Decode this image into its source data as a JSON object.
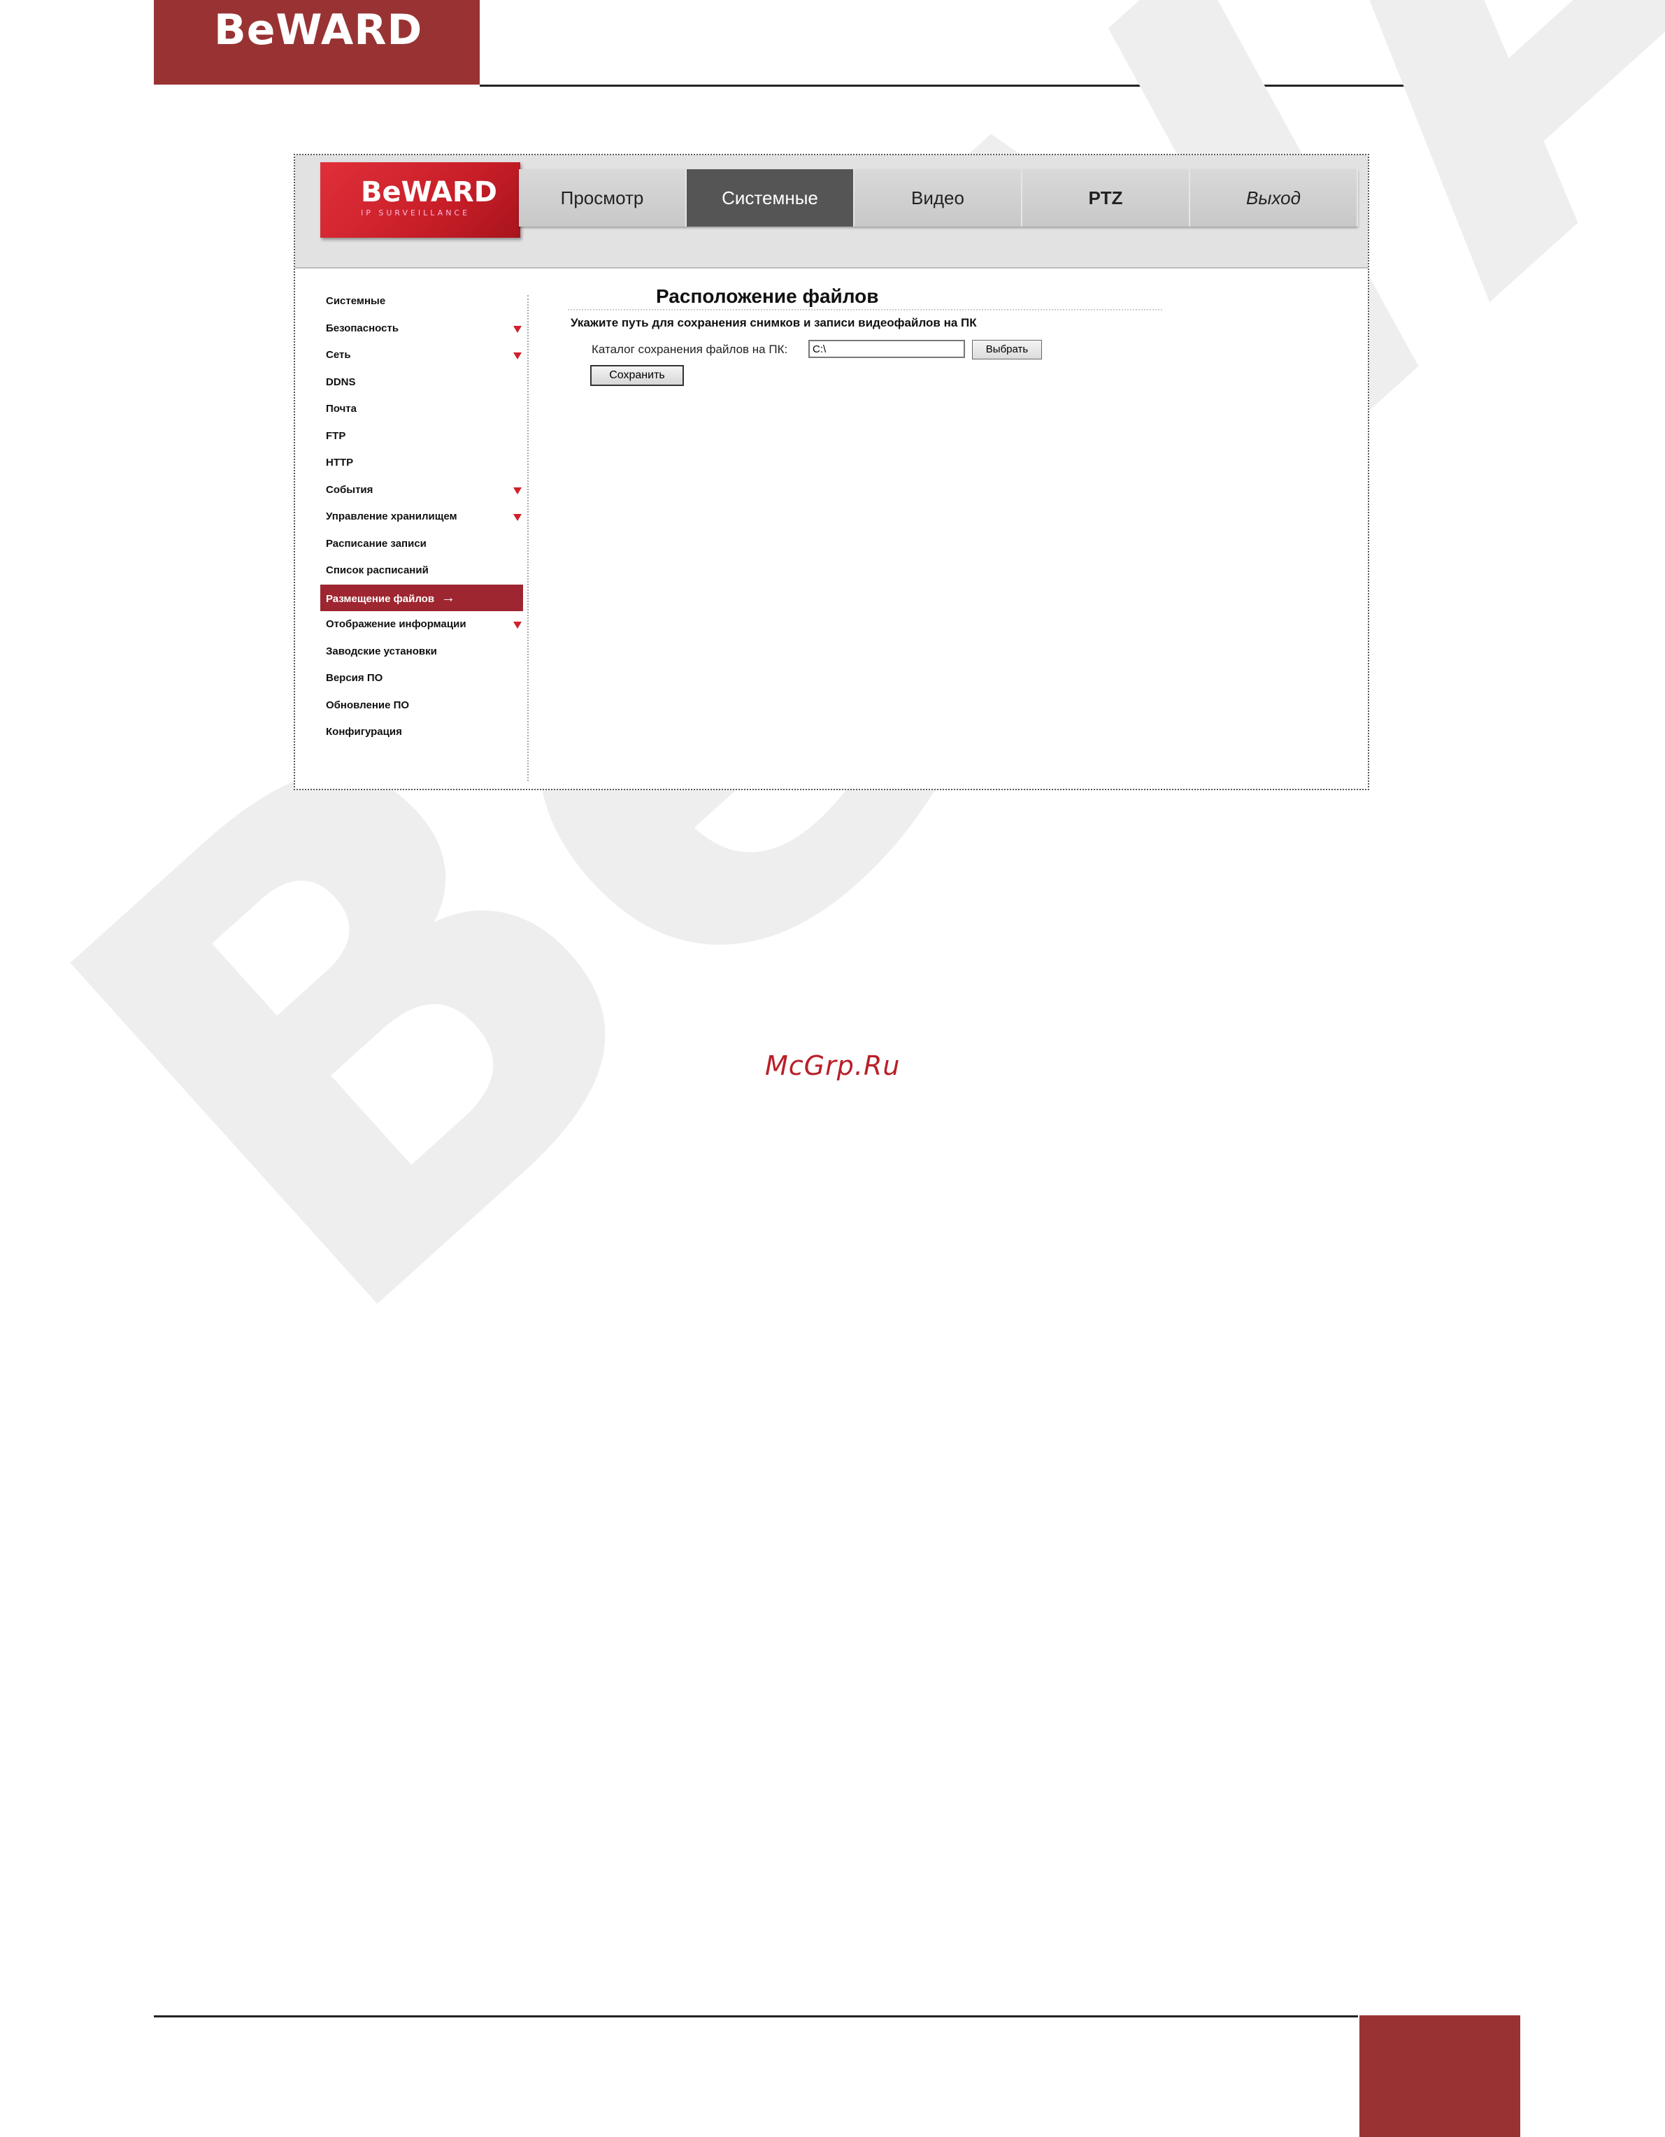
{
  "doc": {
    "logo_text": "BeWARD",
    "watermark_text": "BeWARD",
    "site_mark": "McGrp.Ru"
  },
  "camera_ui": {
    "logo_text": "BeWARD",
    "logo_sub": "IP SURVEILLANCE",
    "tabs": [
      {
        "label": "Просмотр"
      },
      {
        "label": "Системные"
      },
      {
        "label": "Видео"
      },
      {
        "label": "PTZ"
      },
      {
        "label": "Выход"
      }
    ],
    "sidebar": [
      {
        "label": "Системные"
      },
      {
        "label": "Безопасность"
      },
      {
        "label": "Сеть"
      },
      {
        "label": "DDNS"
      },
      {
        "label": "Почта"
      },
      {
        "label": "FTP"
      },
      {
        "label": "HTTP"
      },
      {
        "label": "События"
      },
      {
        "label": "Управление хранилищем"
      },
      {
        "label": "Расписание записи"
      },
      {
        "label": "Список расписаний"
      },
      {
        "label": "Размещение файлов",
        "arrow": "→"
      },
      {
        "label": "Отображение информации"
      },
      {
        "label": "Заводские установки"
      },
      {
        "label": "Версия ПО"
      },
      {
        "label": "Обновление ПО"
      },
      {
        "label": "Конфигурация"
      }
    ],
    "content": {
      "title": "Расположение файлов",
      "subtitle": "Укажите путь для сохранения снимков и записи видеофайлов на ПК",
      "field_label": "Каталог сохранения файлов на ПК:",
      "field_value": "C:\\",
      "browse_label": "Выбрать",
      "save_label": "Сохранить"
    }
  },
  "colors": {
    "brand": "#993333",
    "active_tab": "#555555",
    "active_sidebar": "#9e2630",
    "arrow": "#d0202a"
  }
}
